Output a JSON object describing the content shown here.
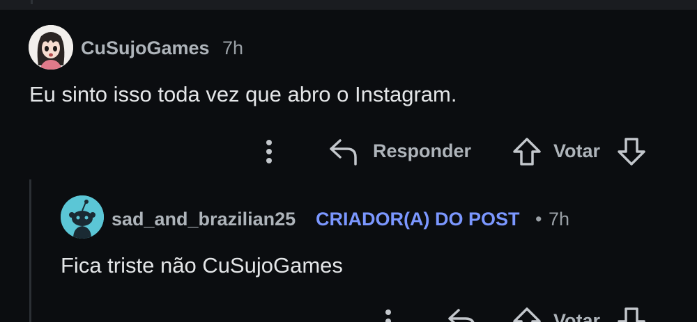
{
  "comment": {
    "username": "CuSujoGames",
    "time": "7h",
    "text": "Eu sinto isso toda vez que abro o Instagram.",
    "actions": {
      "reply_label": "Responder",
      "vote_label": "Votar"
    }
  },
  "reply": {
    "username": "sad_and_brazilian25",
    "badge": "CRIADOR(A) DO POST",
    "separator": "•",
    "time": "7h",
    "text": "Fica triste não CuSujoGames",
    "actions": {
      "vote_label": "Votar"
    }
  },
  "icons": [
    "more-vertical-icon",
    "reply-arrow-icon",
    "upvote-arrow-icon",
    "downvote-arrow-icon",
    "reddit-snoo-icon"
  ],
  "colors": {
    "background": "#0b0d10",
    "username": "#aeb4ba",
    "op_badge": "#7b97ff",
    "avatar2_bg": "#5bc6d6"
  }
}
